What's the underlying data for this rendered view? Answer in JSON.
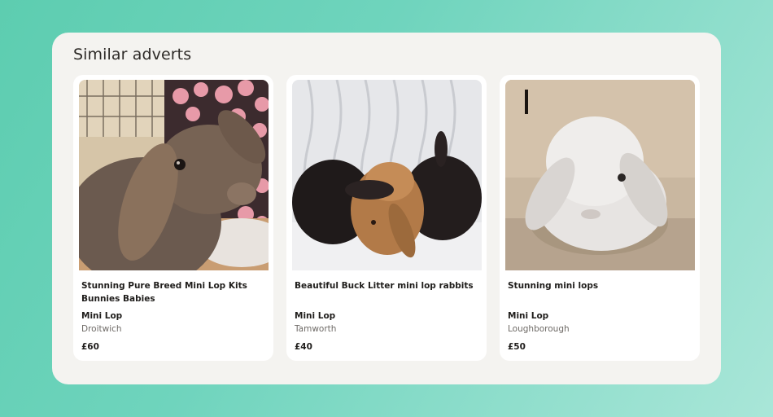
{
  "section": {
    "heading": "Similar adverts"
  },
  "adverts": [
    {
      "title": "Stunning Pure Breed Mini Lop Kits Bunnies Babies",
      "breed": "Mini Lop",
      "location": "Droitwich",
      "price": "£60"
    },
    {
      "title": "Beautiful Buck Litter mini lop rabbits",
      "breed": "Mini Lop",
      "location": "Tamworth",
      "price": "£40"
    },
    {
      "title": "Stunning mini lops",
      "breed": "Mini Lop",
      "location": "Loughborough",
      "price": "£50"
    }
  ],
  "colors": {
    "background_gradient_start": "#5dcdb0",
    "background_gradient_end": "#a9e6d8",
    "panel": "#f4f3f0",
    "card": "#ffffff",
    "text_primary": "#1f1d1b",
    "text_secondary": "#6e6a66"
  }
}
